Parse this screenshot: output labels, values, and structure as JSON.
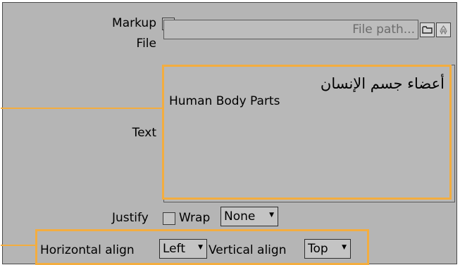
{
  "markup": {
    "label": "Markup",
    "checked": false
  },
  "file": {
    "label": "File",
    "placeholder": "File path...",
    "open_icon": "folder-icon",
    "recent_icon": "recycle-icon"
  },
  "text": {
    "label": "Text",
    "line_arabic": "أعضاء جسم الإنسان",
    "line_english": "Human Body Parts"
  },
  "justify": {
    "label": "Justify",
    "checked": false
  },
  "wrap": {
    "label": "Wrap",
    "value": "None"
  },
  "horizontal_align": {
    "label": "Horizontal align",
    "value": "Left"
  },
  "vertical_align": {
    "label": "Vertical align",
    "value": "Top"
  },
  "colors": {
    "highlight": "#f3ad3f",
    "panel": "#b5b5b5"
  }
}
